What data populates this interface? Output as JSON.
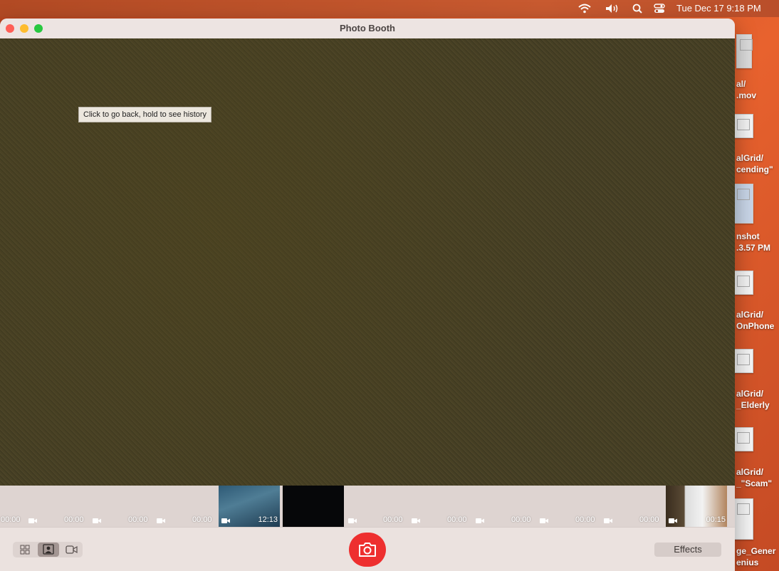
{
  "menubar": {
    "datetime": "Tue Dec 17  9:18 PM"
  },
  "desktop": {
    "items": [
      {
        "line1": "al/",
        "line2": ".mov"
      },
      {
        "line1": "alGrid/",
        "line2": "cending\""
      },
      {
        "line1": "nshot",
        "line2": ".3.57 PM"
      },
      {
        "line1": "alGrid/",
        "line2": "OnPhone"
      },
      {
        "line1": "alGrid/",
        "line2": "_Elderly"
      },
      {
        "line1": "alGrid/",
        "line2": "_\"Scam\""
      },
      {
        "line1": "ge_Gener",
        "line2": "enius"
      }
    ]
  },
  "window": {
    "title": "Photo Booth"
  },
  "tooltip": {
    "text": "Click to go back, hold to see history"
  },
  "filmstrip": {
    "clips": [
      {
        "duration": "00:00"
      },
      {
        "duration": "00:00"
      },
      {
        "duration": "00:00"
      },
      {
        "duration": "00:00"
      },
      {
        "duration": "12:13"
      },
      {
        "duration": ""
      },
      {
        "duration": "00:00"
      },
      {
        "duration": "00:00"
      },
      {
        "duration": "00:00"
      },
      {
        "duration": "00:00"
      },
      {
        "duration": "00:00"
      },
      {
        "duration": "00:15"
      }
    ]
  },
  "toolbar": {
    "effects_label": "Effects"
  },
  "colors": {
    "close": "#ff5f57",
    "minimize": "#febc2e",
    "zoom": "#28c840",
    "shutter": "#ee2f2f"
  }
}
